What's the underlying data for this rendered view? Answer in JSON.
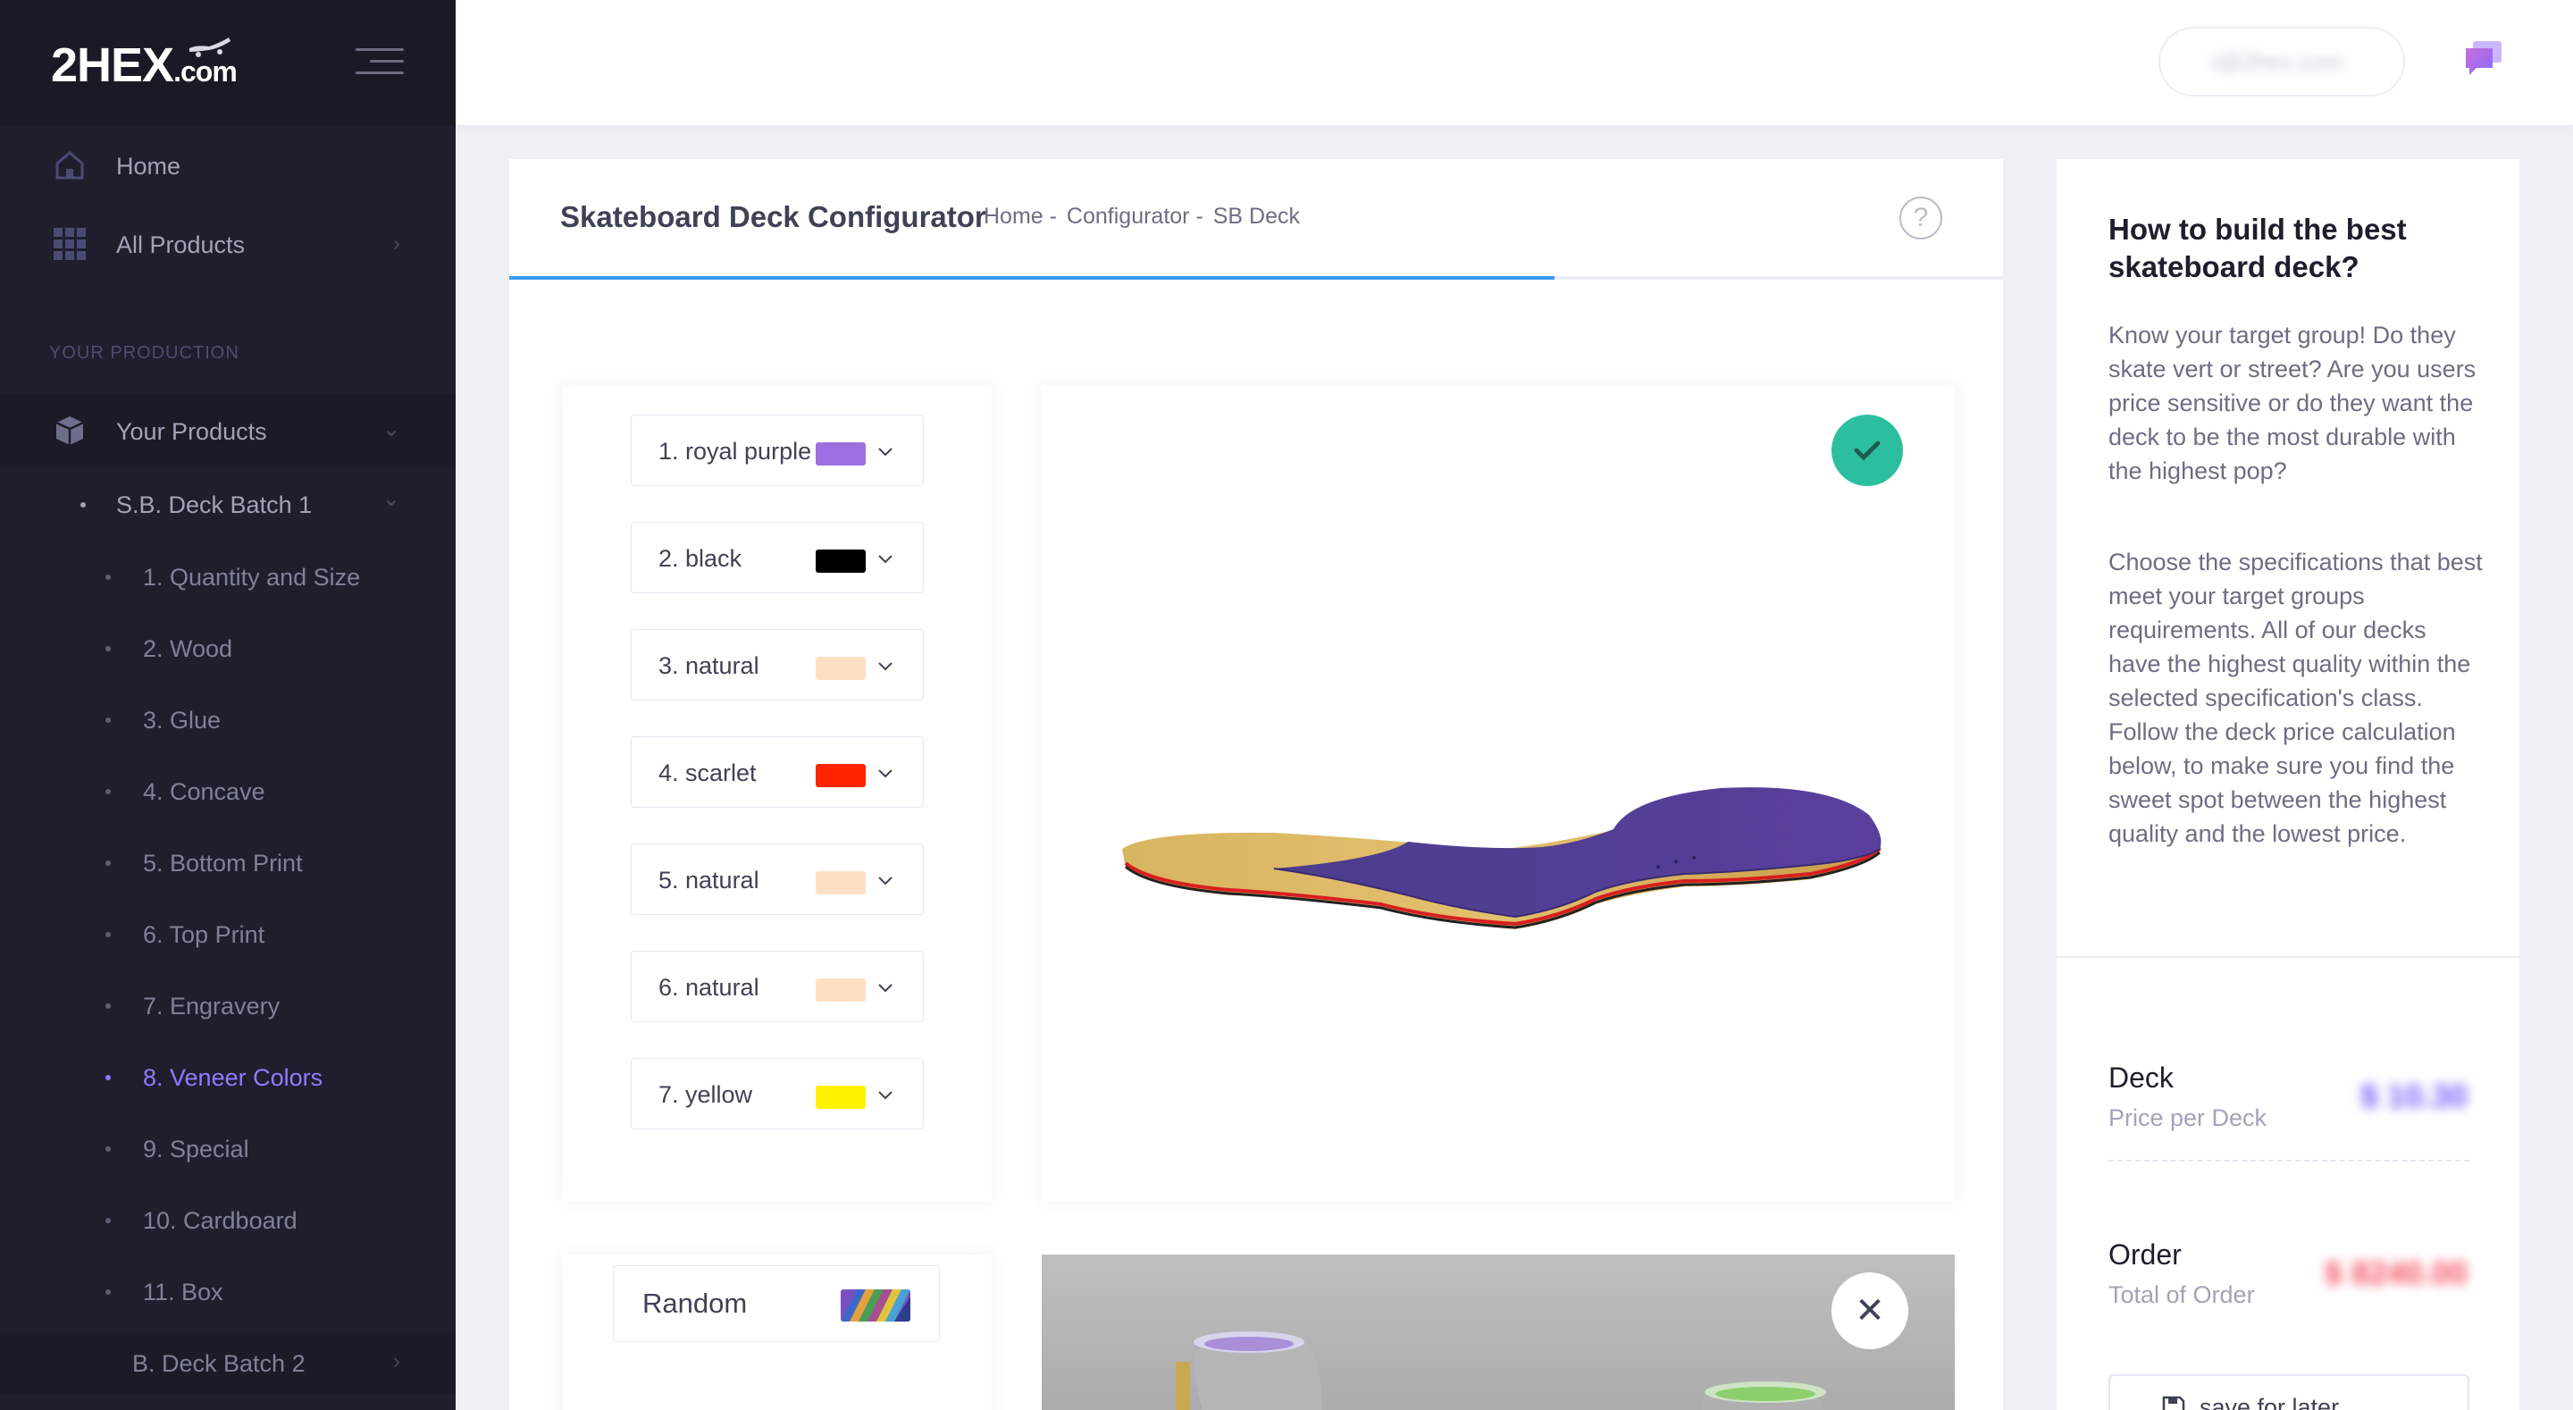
{
  "brand": {
    "logo_main": "2HEX",
    "logo_suffix": ".com"
  },
  "header": {
    "user_email": "t@2hex.com"
  },
  "sidebar": {
    "items": [
      {
        "label": "Home",
        "icon": "home-icon"
      },
      {
        "label": "All Products",
        "icon": "grid-icon"
      }
    ],
    "section_title": "YOUR PRODUCTION",
    "your_products": {
      "label": "Your Products",
      "icon": "box-icon"
    },
    "batch1": "S.B. Deck Batch 1",
    "steps": [
      "1. Quantity and Size",
      "2. Wood",
      "3. Glue",
      "4. Concave",
      "5. Bottom Print",
      "6. Top Print",
      "7. Engravery",
      "8. Veneer Colors",
      "9. Special",
      "10. Cardboard",
      "11. Box"
    ],
    "active_step": "8. Veneer Colors",
    "batch2": "B. Deck Batch 2"
  },
  "main": {
    "title": "Skateboard Deck Configurator",
    "breadcrumb": [
      "Home -",
      "Configurator -",
      "SB Deck"
    ],
    "progress": 0.7,
    "veneers": [
      {
        "label": "1. royal purple",
        "color": "#9d6fe0"
      },
      {
        "label": "2. black",
        "color": "#000000"
      },
      {
        "label": "3. natural",
        "color": "#fde0c3"
      },
      {
        "label": "4. scarlet",
        "color": "#ff2400"
      },
      {
        "label": "5. natural",
        "color": "#fde0c3"
      },
      {
        "label": "6. natural",
        "color": "#fde0c3"
      },
      {
        "label": "7. yellow",
        "color": "#fff200"
      }
    ],
    "random_label": "Random"
  },
  "info": {
    "title": "How to build the best skateboard deck?",
    "para1": "Know your target group! Do they skate vert or street? Are you users price sensitive or do they want the deck to be the most durable with the highest pop?",
    "para2": "Choose the specifications that best meet your target groups requirements. All of our decks have the highest quality within the selected specification's class. Follow the deck price calculation below, to make sure you find the sweet spot between the highest quality and the lowest price.",
    "deck_title": "Deck",
    "deck_sub": "Price per Deck",
    "deck_value": "$ 10.30",
    "order_title": "Order",
    "order_sub": "Total of Order",
    "order_value": "$ 8240.00",
    "save_label": "save for later"
  },
  "colors": {
    "accent": "#8c7cff",
    "progress": "#3b9cf0",
    "success": "#2cbf9f",
    "deck_price": "#6d5dfc",
    "order_price": "#f64e60"
  }
}
